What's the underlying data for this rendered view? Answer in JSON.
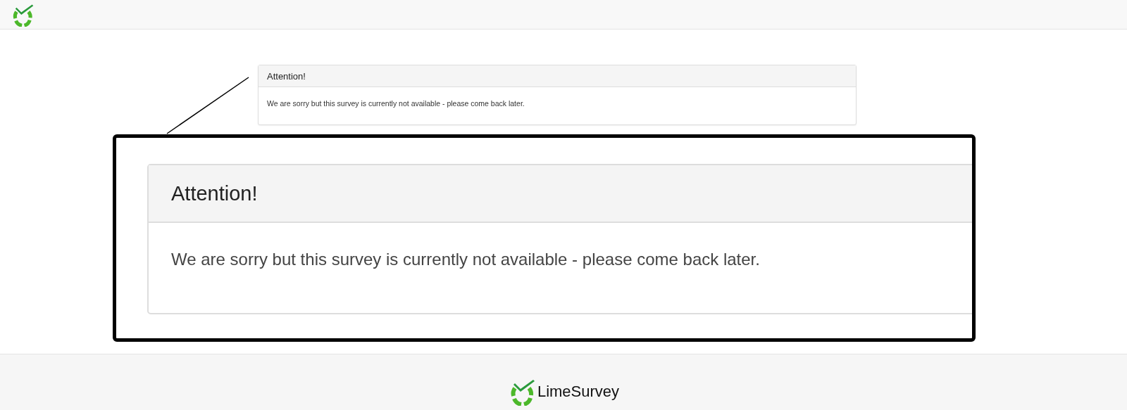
{
  "notice": {
    "title": "Attention!",
    "message": "We are sorry but this survey is currently not available - please come back later."
  },
  "zoom_callout": {
    "title": "Attention!",
    "message": "We are sorry but this survey is currently not available - please come back later."
  },
  "footer": {
    "brand": "LimeSurvey"
  }
}
